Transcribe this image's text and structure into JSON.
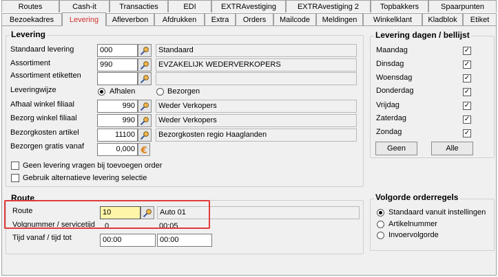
{
  "tabs_row1": [
    "Routes",
    "Cash-it",
    "Transacties",
    "EDI",
    "EXTRAvestiging",
    "EXTRAvestiging 2",
    "Topbakkers",
    "Spaarpunten"
  ],
  "tabs_row2": [
    "Bezoekadres",
    "Levering",
    "Afleverbon",
    "Afdrukken",
    "Extra",
    "Orders",
    "Mailcode",
    "Meldingen",
    "Winkelklant",
    "Kladblok",
    "Etiket"
  ],
  "levering": {
    "title": "Levering",
    "standaard_levering": {
      "label": "Standaard levering",
      "code": "000",
      "desc": "Standaard"
    },
    "assortiment": {
      "label": "Assortiment",
      "code": "990",
      "desc": "EVZAKELIJK  WEDERVERKOPERS"
    },
    "assortiment_etiketten": {
      "label": "Assortiment etiketten",
      "code": "",
      "desc": ""
    },
    "leveringwijze": {
      "label": "Leveringwijze",
      "opt1": "Afhalen",
      "opt2": "Bezorgen"
    },
    "afhaal": {
      "label": "Afhaal winkel filiaal",
      "code": "990",
      "desc": "Weder Verkopers"
    },
    "bezorg": {
      "label": "Bezorg winkel filiaal",
      "code": "990",
      "desc": "Weder Verkopers"
    },
    "bezorgkosten": {
      "label": "Bezorgkosten artikel",
      "code": "11100",
      "desc": "Bezorgkosten regio Haaglanden"
    },
    "gratis": {
      "label": "Bezorgen gratis vanaf",
      "value": "0,000"
    },
    "check1": "Geen levering vragen bij toevoegen order",
    "check2": "Gebruik alternatieve levering selectie"
  },
  "dagen": {
    "title": "Levering dagen / bellijst",
    "days": [
      "Maandag",
      "Dinsdag",
      "Woensdag",
      "Donderdag",
      "Vrijdag",
      "Zaterdag",
      "Zondag"
    ],
    "check_mark": "✓",
    "btn_geen": "Geen",
    "btn_alle": "Alle"
  },
  "route": {
    "title": "Route",
    "route_label": "Route",
    "route_code": "10",
    "route_desc": "Auto 01",
    "volg_label": "Volgnummer / servicetijd",
    "volg_value": "0",
    "service_value": "00:05",
    "tijd_label": "Tijd vanaf / tijd tot",
    "tijd_vanaf": "00:00",
    "tijd_tot": "00:00"
  },
  "volgorde": {
    "title": "Volgorde orderregels",
    "opts": [
      "Standaard vanuit instellingen",
      "Artikelnummer",
      "Invoervolgorde"
    ]
  },
  "colors": {
    "active_tab": "#d0312d",
    "highlight": "#fff5a8",
    "callout": "#e03a3a"
  },
  "icons": {
    "lookup": "key-search-icon",
    "euro": "euro-icon"
  }
}
